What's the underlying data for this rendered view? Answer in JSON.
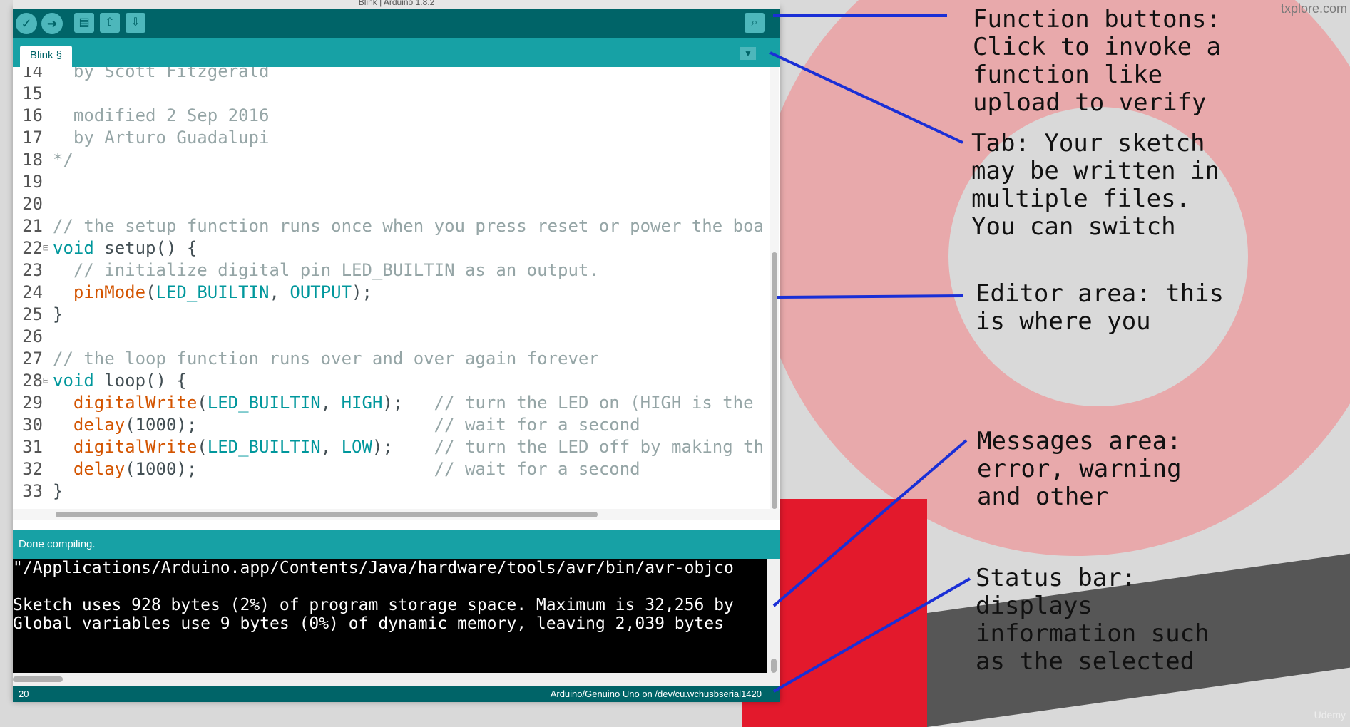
{
  "window": {
    "title": "Blink | Arduino 1.8.2",
    "watermark": "txplore.com",
    "corner_mark": "Udemy"
  },
  "toolbar": {
    "buttons": [
      {
        "name": "verify",
        "icon": "check-icon"
      },
      {
        "name": "upload",
        "icon": "arrow-right-icon"
      },
      {
        "name": "new",
        "icon": "new-file-icon"
      },
      {
        "name": "open",
        "icon": "arrow-up-icon"
      },
      {
        "name": "save",
        "icon": "arrow-down-icon"
      }
    ],
    "serial_monitor_icon": "magnifier-icon"
  },
  "tabs": [
    {
      "label": "Blink §"
    }
  ],
  "editor": {
    "lines": [
      {
        "n": "14",
        "code": "  by Scott Fitzgerald"
      },
      {
        "n": "15",
        "code": ""
      },
      {
        "n": "16",
        "code": "  modified 2 Sep 2016"
      },
      {
        "n": "17",
        "code": "  by Arturo Guadalupi"
      },
      {
        "n": "18",
        "code": "*/"
      },
      {
        "n": "19",
        "code": ""
      },
      {
        "n": "20",
        "code": ""
      },
      {
        "n": "21",
        "code": "// the setup function runs once when you press reset or power the boa"
      },
      {
        "n": "22",
        "code": "void setup() {"
      },
      {
        "n": "23",
        "code": "  // initialize digital pin LED_BUILTIN as an output."
      },
      {
        "n": "24",
        "code": "  pinMode(LED_BUILTIN, OUTPUT);"
      },
      {
        "n": "25",
        "code": "}"
      },
      {
        "n": "26",
        "code": ""
      },
      {
        "n": "27",
        "code": "// the loop function runs over and over again forever"
      },
      {
        "n": "28",
        "code": "void loop() {"
      },
      {
        "n": "29",
        "code": "  digitalWrite(LED_BUILTIN, HIGH);   // turn the LED on (HIGH is the"
      },
      {
        "n": "30",
        "code": "  delay(1000);                       // wait for a second"
      },
      {
        "n": "31",
        "code": "  digitalWrite(LED_BUILTIN, LOW);    // turn the LED off by making th"
      },
      {
        "n": "32",
        "code": "  delay(1000);                       // wait for a second"
      },
      {
        "n": "33",
        "code": "}"
      }
    ]
  },
  "messages": {
    "status": "Done compiling.",
    "console": [
      "\"/Applications/Arduino.app/Contents/Java/hardware/tools/avr/bin/avr-objco",
      "",
      "Sketch uses 928 bytes (2%) of program storage space. Maximum is 32,256 by",
      "Global variables use 9 bytes (0%) of dynamic memory, leaving 2,039 bytes"
    ]
  },
  "statusbar": {
    "line": "20",
    "board": "Arduino/Genuino Uno on /dev/cu.wchusbserial1420"
  },
  "annotations": {
    "function_buttons": "Function buttons:\nClick to invoke a\nfunction like\nupload to verify",
    "tab": "Tab: Your sketch\nmay be written in\nmultiple files.\nYou can switch",
    "editor_area": "Editor area: this\nis where you",
    "messages_area": "Messages area:\nerror, warning\nand other",
    "status_bar": "Status bar:\ndisplays\ninformation such\nas the selected"
  },
  "colors": {
    "toolbar": "#006468",
    "tabbar": "#17a1a5",
    "connector": "#1a2fd6"
  }
}
